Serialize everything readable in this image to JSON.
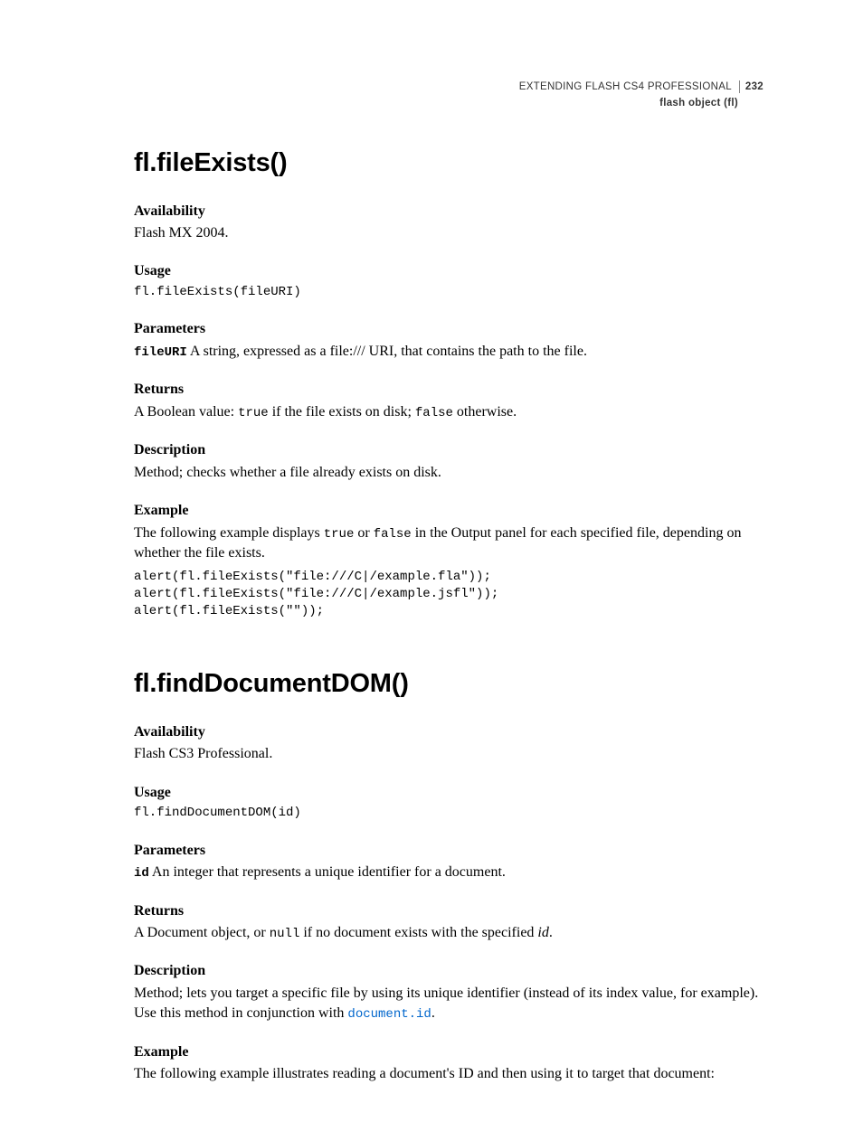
{
  "header": {
    "book_title": "EXTENDING FLASH CS4 PROFESSIONAL",
    "page_number": "232",
    "chapter": "flash object (fl)"
  },
  "method1": {
    "title": "fl.fileExists()",
    "availability_label": "Availability",
    "availability_text": "Flash MX 2004.",
    "usage_label": "Usage",
    "usage_code": "fl.fileExists(fileURI)",
    "parameters_label": "Parameters",
    "param_name": "fileURI",
    "param_desc": "  A string, expressed as a file:/// URI, that contains the path to the file.",
    "returns_label": "Returns",
    "returns_pre": "A Boolean value: ",
    "returns_code1": "true",
    "returns_mid": " if the file exists on disk; ",
    "returns_code2": "false",
    "returns_post": " otherwise.",
    "description_label": "Description",
    "description_text": "Method; checks whether a file already exists on disk.",
    "example_label": "Example",
    "example_intro_pre": "The following example displays ",
    "example_intro_code1": "true",
    "example_intro_mid": " or ",
    "example_intro_code2": "false",
    "example_intro_post": " in the Output panel for each specified file, depending on whether the file exists.",
    "example_code": "alert(fl.fileExists(\"file:///C|/example.fla\"));\nalert(fl.fileExists(\"file:///C|/example.jsfl\"));\nalert(fl.fileExists(\"\"));"
  },
  "method2": {
    "title": "fl.findDocumentDOM()",
    "availability_label": "Availability",
    "availability_text": "Flash CS3 Professional.",
    "usage_label": "Usage",
    "usage_code": "fl.findDocumentDOM(id)",
    "parameters_label": "Parameters",
    "param_name": "id",
    "param_desc": "  An integer that represents a unique identifier for a document.",
    "returns_label": "Returns",
    "returns_pre": "A Document object, or ",
    "returns_code1": "null",
    "returns_mid": " if no document exists with the specified ",
    "returns_ital": "id",
    "returns_post": ".",
    "description_label": "Description",
    "description_pre": "Method; lets you target a specific file by using its unique identifier (instead of its index value, for example). Use this method in conjunction with ",
    "description_link": "document.id",
    "description_post": ".",
    "example_label": "Example",
    "example_intro": "The following example illustrates reading a document's ID and then using it to target that document:"
  }
}
